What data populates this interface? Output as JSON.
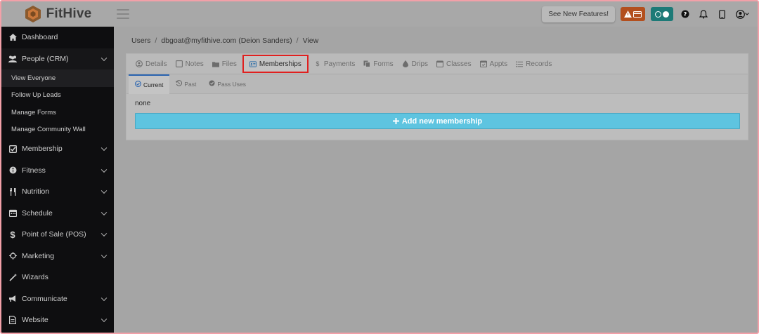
{
  "app": {
    "name": "FitHive"
  },
  "topbar": {
    "features_label": "See New Features!",
    "warning_icon": "warning-icon",
    "card_icon": "credit-card-icon",
    "help_icon": "help-icon",
    "bell_icon": "bell-icon",
    "phone_icon": "mobile-icon",
    "user_icon": "user-icon"
  },
  "sidebar": {
    "items": [
      {
        "label": "Dashboard",
        "icon": "home-icon",
        "chevron": false
      },
      {
        "label": "People (CRM)",
        "icon": "users-icon",
        "chevron": true,
        "open": true
      },
      {
        "label": "Membership",
        "icon": "check-square-icon",
        "chevron": true
      },
      {
        "label": "Fitness",
        "icon": "fitness-icon",
        "chevron": true
      },
      {
        "label": "Nutrition",
        "icon": "utensils-icon",
        "chevron": true
      },
      {
        "label": "Schedule",
        "icon": "calendar-icon",
        "chevron": true
      },
      {
        "label": "Point of Sale (POS)",
        "icon": "dollar-icon",
        "chevron": true
      },
      {
        "label": "Marketing",
        "icon": "crosshairs-icon",
        "chevron": true
      },
      {
        "label": "Wizards",
        "icon": "magic-wand-icon",
        "chevron": false
      },
      {
        "label": "Communicate",
        "icon": "bullhorn-icon",
        "chevron": true
      },
      {
        "label": "Website",
        "icon": "file-icon",
        "chevron": true
      }
    ],
    "subitems": [
      {
        "label": "View Everyone",
        "active": true
      },
      {
        "label": "Follow Up Leads"
      },
      {
        "label": "Manage Forms"
      },
      {
        "label": "Manage Community Wall"
      }
    ]
  },
  "breadcrumb": [
    "Users",
    "dbgoat@myfithive.com (Deion Sanders)",
    "View"
  ],
  "tabs": [
    {
      "label": "Details",
      "icon": "user-circle-icon"
    },
    {
      "label": "Notes",
      "icon": "note-icon"
    },
    {
      "label": "Files",
      "icon": "folder-icon"
    },
    {
      "label": "Memberships",
      "icon": "id-card-icon",
      "active": true
    },
    {
      "label": "Payments",
      "icon": "dollar-icon"
    },
    {
      "label": "Forms",
      "icon": "copy-icon"
    },
    {
      "label": "Drips",
      "icon": "drop-icon"
    },
    {
      "label": "Classes",
      "icon": "calendar-icon"
    },
    {
      "label": "Appts",
      "icon": "calendar-check-icon"
    },
    {
      "label": "Records",
      "icon": "list-icon"
    }
  ],
  "subtabs": [
    {
      "label": "Current",
      "icon": "check-circle-icon",
      "active": true
    },
    {
      "label": "Past",
      "icon": "history-icon"
    },
    {
      "label": "Pass Uses",
      "icon": "check-circle-icon"
    }
  ],
  "content": {
    "empty_text": "none",
    "add_button_label": "Add new membership"
  },
  "colors": {
    "sidebar_bg": "#0e0e10",
    "accent_blue": "#5ec4e0",
    "highlight_red": "#e0201f",
    "warning_orange": "#b34f1e",
    "teal": "#1d7a77"
  }
}
